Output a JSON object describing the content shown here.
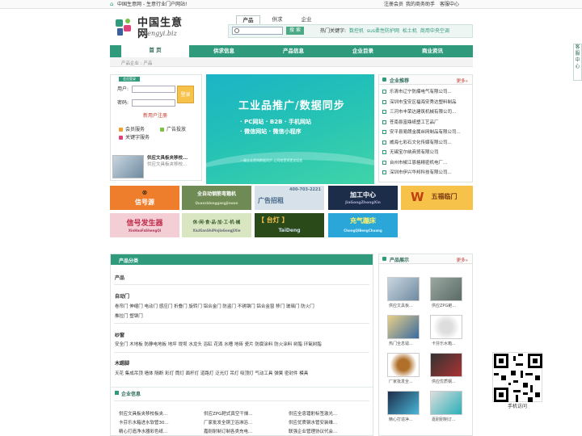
{
  "topbar": {
    "left_text": "中国生意网 - 生意行业门户网站!",
    "links": [
      "注册会员",
      "我的商务助手",
      "客服中心"
    ]
  },
  "logo": {
    "cn": "中国生意网",
    "en": "shengyi.biz"
  },
  "search": {
    "tabs": [
      "产品",
      "供求",
      "企业"
    ],
    "active_tab": "产品",
    "placeholder": "",
    "button": "搜 索",
    "hot_label": "热门关键字:",
    "hot_items": [
      "数控机",
      "sus柔性防护网",
      "松土机",
      "商用中央空调"
    ]
  },
  "nav": {
    "items": [
      "首 页",
      "供求信息",
      "产品信息",
      "企业目录",
      "商业资讯"
    ]
  },
  "breadcrumb": "产品企业 : 产品",
  "login": {
    "tag": "会员登录",
    "user_label": "用户:",
    "pass_label": "密码:",
    "login_btn": "登录",
    "register": "新用户注册",
    "services": [
      "会员服务",
      "广告投放",
      "关键字服务"
    ]
  },
  "featured_product": {
    "name": "供应文具板夹移校...",
    "sub": "供应文具板夹移校..."
  },
  "banner": {
    "title": "工业品推广/数据同步",
    "lines": [
      "· PC网站 · B2B · 手机网站",
      "· 微信网站 · 微信小程序"
    ],
    "small": "一键企业营销数据同步,让网络营销更加轻松"
  },
  "recommend": {
    "title": "企业推荐",
    "more": "更多»",
    "items": [
      "乐清市辽宁防爆电气有限公司...",
      "深圳市宝安区福海安秀达塑料制品",
      "三河市丰荣达建筑机械有限公司...",
      "苍南县富鼎纸塑工艺品厂",
      "安平县易朗金属丝网制品有限公司...",
      "威海七彩石文化传媒有限公司...",
      "无锡宝尔纳商贸有限公司",
      "台州市椒江恩格精密机电厂...",
      "深圳市伊兴华邦科技有限公司..."
    ]
  },
  "ads": [
    {
      "text": "信号源",
      "sub": ""
    },
    {
      "text": "全自动钢筋弯箍机",
      "sub": "Quanzidonggangjinwan"
    },
    {
      "text": "广告招租",
      "sub": "400-703-2221"
    },
    {
      "text": "加工中心",
      "sub": "JiaGongZhongXin"
    },
    {
      "text": "五福临门",
      "sub": ""
    },
    {
      "text": "信号发生器",
      "sub": "XinHaoFaShengQi"
    },
    {
      "text": "休·闲·食·品·加·工·机·械",
      "sub": "XiuXianShiPinJiaGongJiXie"
    },
    {
      "text": "【 台灯 】",
      "sub": "TaiDeng"
    },
    {
      "text": "充气蹦床",
      "sub": "ChongQiBengChuang"
    }
  ],
  "categories": {
    "title": "产品分类",
    "top": "产品",
    "groups": [
      {
        "name": "自动门",
        "items": [
          "卷帘门",
          "伸缩门",
          "电动门",
          "感应门",
          "折叠门",
          "旋转门",
          "铝合金门",
          "防盗门",
          "不锈钢门",
          "铝合金窗",
          "移门",
          "玻璃门",
          "防火门",
          "推拉门",
          "塑钢门"
        ]
      },
      {
        "name": "纱窗",
        "items": [
          "安全门",
          "木地板",
          "防静电地板",
          "地坪",
          "堤坝",
          "水龙头",
          "浴缸",
          "花洒",
          "水槽",
          "地砖",
          "瓷片",
          "防腐涂料",
          "防火涂料",
          "树脂",
          "环氧树脂"
        ]
      },
      {
        "name": "木踢脚",
        "items": [
          "天花",
          "集成吊顶",
          "墙体",
          "隔断",
          "彩灯",
          "筒灯",
          "面杆灯",
          "道路灯",
          "泛光灯",
          "吊灯",
          "吸顶灯",
          "气动工具",
          "弹簧",
          "密封件",
          "模具"
        ]
      }
    ]
  },
  "company_info": {
    "title": "企业信息",
    "items": [
      "供应文具板夹移校板夹...",
      "供应ZPG耙式真空干燥...",
      "供应全息镭射标签激光...",
      "卡芬乐水箱进水软管30...",
      "厂家批发全铜卫浴淋浴...",
      "供应优质钢水管安装维...",
      "精心打造净水器彩色纸...",
      "嘉耐耐制订制各类充电...",
      "联强企业管理协议代会..."
    ]
  },
  "product_show": {
    "title": "产品展示",
    "more": "更多»",
    "items": [
      "供应文具板...",
      "供应ZPG耙...",
      "热门全息镭...",
      "卡芬乐水箱...",
      "厂家批发全...",
      "供应优质钢...",
      "精心打造净...",
      "嘉耐耐制订..."
    ]
  },
  "side_tab": "客服中心",
  "qr_caption": "手机访问"
}
